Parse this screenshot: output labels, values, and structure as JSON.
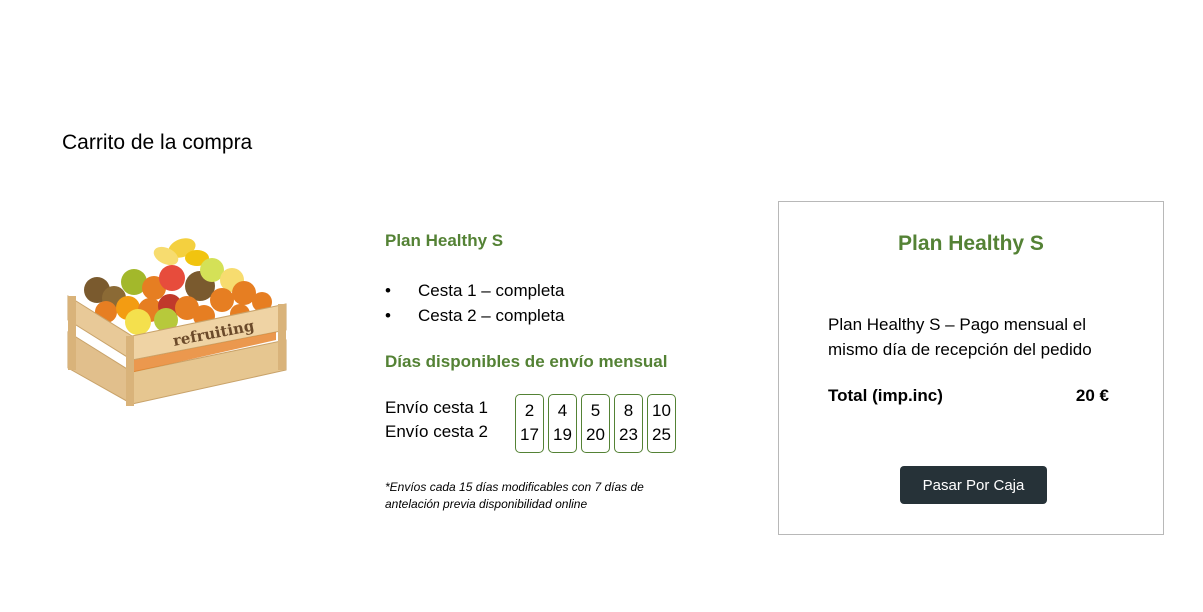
{
  "page": {
    "title": "Carrito de la compra"
  },
  "product": {
    "image_icon": "fruit-crate-image",
    "brand_label": "refruiting",
    "plan_name": "Plan Healthy S",
    "baskets": [
      {
        "bullet": "•",
        "label": "Cesta 1 – completa"
      },
      {
        "bullet": "•",
        "label": "Cesta 2 – completa"
      }
    ],
    "days_title": "Días disponibles de envío mensual",
    "shipping_rows": [
      {
        "label": "Envío cesta 1"
      },
      {
        "label": "Envío cesta 2"
      }
    ],
    "day_columns": [
      {
        "row1": "2",
        "row2": "17"
      },
      {
        "row1": "4",
        "row2": "19"
      },
      {
        "row1": "5",
        "row2": "20"
      },
      {
        "row1": "8",
        "row2": "23"
      },
      {
        "row1": "10",
        "row2": "25"
      }
    ],
    "note": "*Envíos cada 15 días modificables con 7 días de antelación previa disponibilidad online"
  },
  "summary": {
    "title": "Plan Healthy S",
    "description": "Plan Healthy S – Pago mensual el mismo día de recepción del pedido",
    "total_label": "Total (imp.inc)",
    "total_value": "20 €",
    "checkout_label": "Pasar Por Caja"
  },
  "colors": {
    "accent": "#548235",
    "button": "#263238",
    "card_border": "#b8b8b8"
  }
}
